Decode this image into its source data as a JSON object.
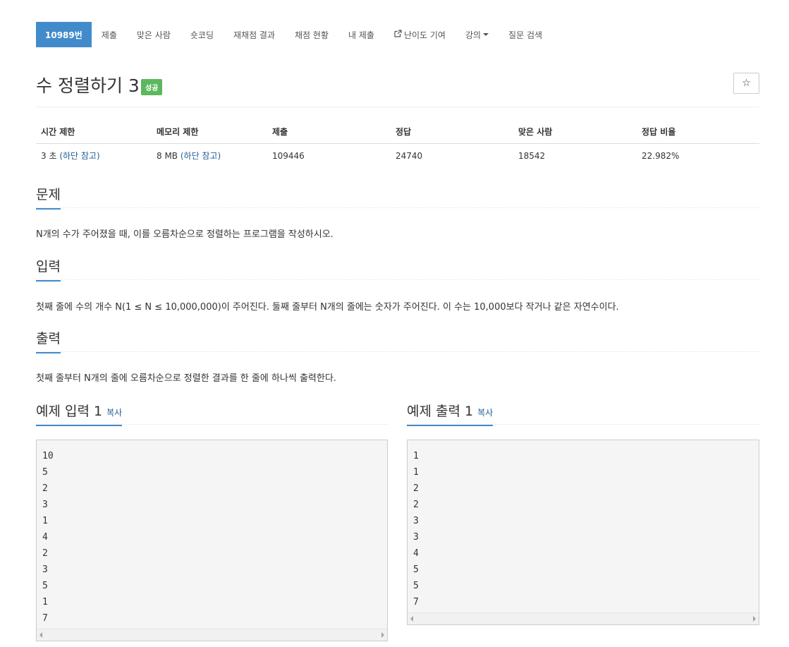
{
  "nav": {
    "problem_number": "10989번",
    "items": [
      "제출",
      "맞은 사람",
      "숏코딩",
      "재채점 결과",
      "채점 현황",
      "내 제출"
    ],
    "difficulty": "난이도 기여",
    "lecture": "강의",
    "search": "질문 검색"
  },
  "problem": {
    "title": "수 정렬하기 3",
    "badge": "성공",
    "star": "☆"
  },
  "info": {
    "headers": [
      "시간 제한",
      "메모리 제한",
      "제출",
      "정답",
      "맞은 사람",
      "정답 비율"
    ],
    "time_value": "3 초 ",
    "time_note": "(하단 참고)",
    "memory_value": "8 MB ",
    "memory_note": "(하단 참고)",
    "submissions": "109446",
    "accepted": "24740",
    "solvers": "18542",
    "ratio": "22.982%"
  },
  "sections": {
    "problem_title": "문제",
    "problem_text": "N개의 수가 주어졌을 때, 이를 오름차순으로 정렬하는 프로그램을 작성하시오.",
    "input_title": "입력",
    "input_text": "첫째 줄에 수의 개수 N(1 ≤ N ≤ 10,000,000)이 주어진다. 둘째 줄부터 N개의 줄에는 숫자가 주어진다. 이 수는 10,000보다 작거나 같은 자연수이다.",
    "output_title": "출력",
    "output_text": "첫째 줄부터 N개의 줄에 오름차순으로 정렬한 결과를 한 줄에 하나씩 출력한다."
  },
  "samples": {
    "input_title": "예제 입력 1",
    "output_title": "예제 출력 1",
    "copy_label": "복사",
    "input_text": "10\n5\n2\n3\n1\n4\n2\n3\n5\n1\n7",
    "output_text": "1\n1\n2\n2\n3\n3\n4\n5\n5\n7"
  },
  "colors": {
    "active_tab": "#428bca",
    "success_badge": "#5cb85c",
    "link": "#1f5e96"
  }
}
